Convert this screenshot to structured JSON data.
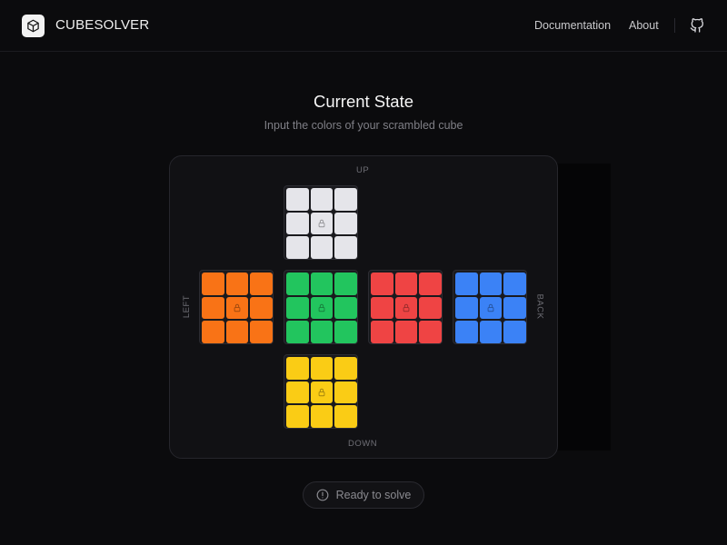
{
  "header": {
    "brand": "CUBESOLVER",
    "nav": {
      "documentation": "Documentation",
      "about": "About"
    },
    "icons": {
      "logo": "cube-icon",
      "github": "github-icon"
    }
  },
  "main": {
    "title": "Current State",
    "subtitle": "Input the colors of your scrambled cube"
  },
  "cube": {
    "labels": {
      "up": "UP",
      "down": "DOWN",
      "left": "LEFT",
      "back": "BACK"
    },
    "colors": {
      "white": "#e5e5ea",
      "orange": "#f97316",
      "green": "#22c55e",
      "red": "#ef4444",
      "blue": "#3b82f6",
      "yellow": "#facc15"
    },
    "faces": [
      {
        "id": "up",
        "color": "white"
      },
      {
        "id": "left",
        "color": "orange"
      },
      {
        "id": "front",
        "color": "green"
      },
      {
        "id": "right",
        "color": "red"
      },
      {
        "id": "back",
        "color": "blue"
      },
      {
        "id": "down",
        "color": "yellow"
      }
    ]
  },
  "status": {
    "text": "Ready to solve",
    "icon": "alert-circle-icon"
  }
}
